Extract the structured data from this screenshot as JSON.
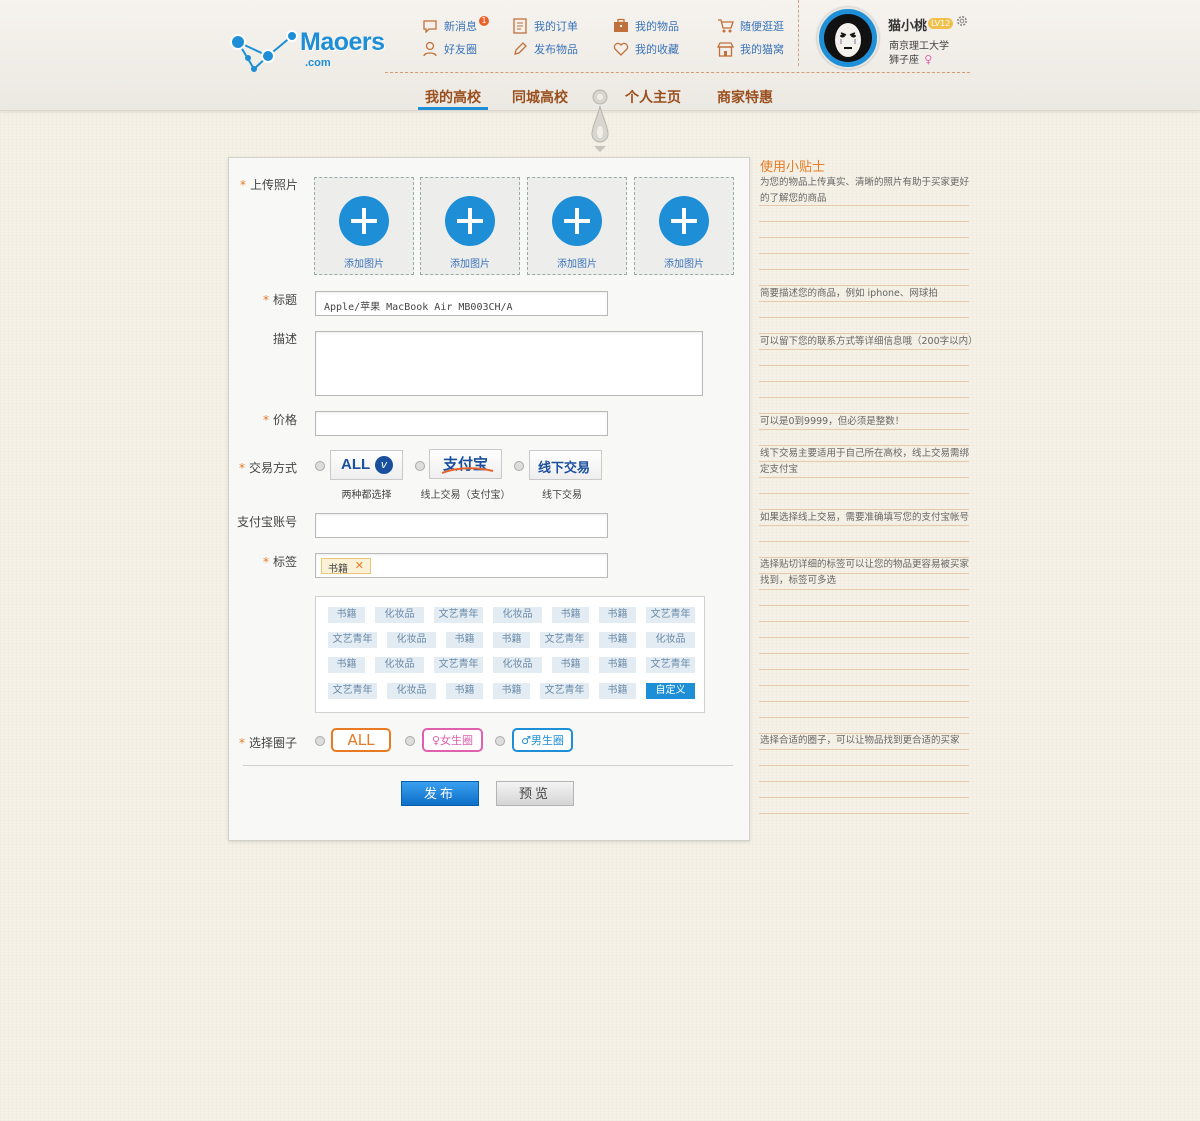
{
  "logo": {
    "name": "Maoers",
    "sub": ".com"
  },
  "header_links": [
    {
      "label": "新消息",
      "badge": "1",
      "icon": "chat-bubble-icon"
    },
    {
      "label": "好友圈",
      "icon": "user-icon"
    },
    {
      "label": "我的订单",
      "icon": "document-icon"
    },
    {
      "label": "发布物品",
      "icon": "pencil-icon"
    },
    {
      "label": "我的物品",
      "icon": "briefcase-icon"
    },
    {
      "label": "我的收藏",
      "icon": "heart-icon"
    },
    {
      "label": "随便逛逛",
      "icon": "cart-icon"
    },
    {
      "label": "我的猫窝",
      "icon": "shop-icon"
    }
  ],
  "user": {
    "name": "猫小桃",
    "level": "LV12",
    "school": "南京理工大学",
    "sign": "狮子座",
    "gender_symbol": "♀"
  },
  "nav": [
    "我的高校",
    "同城高校",
    "个人主页",
    "商家特惠"
  ],
  "form": {
    "upload_label": "上传照片",
    "upload_slots": [
      "添加图片",
      "添加图片",
      "添加图片",
      "添加图片"
    ],
    "title_label": "标题",
    "title_value": "Apple/苹果 MacBook Air MB003CH/A",
    "desc_label": "描述",
    "price_label": "价格",
    "trade_label": "交易方式",
    "trade_options": [
      {
        "logo": "ALL",
        "caption": "两种都选择"
      },
      {
        "logo": "支付宝",
        "caption": "线上交易（支付宝）"
      },
      {
        "logo": "线下交易",
        "caption": "线下交易"
      }
    ],
    "alipay_label": "支付宝账号",
    "tags_label": "标签",
    "selected_tag": "书籍",
    "tag_rows": [
      [
        "书籍",
        "化妆品",
        "文艺青年",
        "化妆品",
        "书籍",
        "书籍",
        "文艺青年"
      ],
      [
        "文艺青年",
        "化妆品",
        "书籍",
        "书籍",
        "文艺青年",
        "书籍",
        "化妆品"
      ],
      [
        "书籍",
        "化妆品",
        "文艺青年",
        "化妆品",
        "书籍",
        "书籍",
        "文艺青年"
      ],
      [
        "文艺青年",
        "化妆品",
        "书籍",
        "书籍",
        "文艺青年",
        "书籍",
        "自定义"
      ]
    ],
    "circle_label": "选择圈子",
    "circles": [
      {
        "label": "ALL",
        "color": "#e97a24"
      },
      {
        "label": "♀女生圈",
        "color": "#e060b0"
      },
      {
        "label": "♂男生圈",
        "color": "#1e8fd6"
      }
    ],
    "publish_button": "发布",
    "preview_button": "预览"
  },
  "tips": {
    "title": "使用小贴士",
    "items": [
      "为您的物品上传真实、清晰的照片有助于买家更好的了解您的商品",
      "简要描述您的商品，例如 iphone、网球拍",
      "可以留下您的联系方式等详细信息哦（200字以内）",
      "可以是0到9999，但必须是整数！",
      "线下交易主要适用于自己所在高校，线上交易需绑定支付宝",
      "如果选择线上交易，需要准确填写您的支付宝帐号",
      "选择贴切详细的标签可以让您的物品更容易被买家找到，标签可多选",
      "选择合适的圈子，可以让物品找到更合适的买家"
    ]
  },
  "colors": {
    "accent": "#1e8fd6",
    "orange": "#e97a24",
    "nav": "#9a4f1e"
  }
}
